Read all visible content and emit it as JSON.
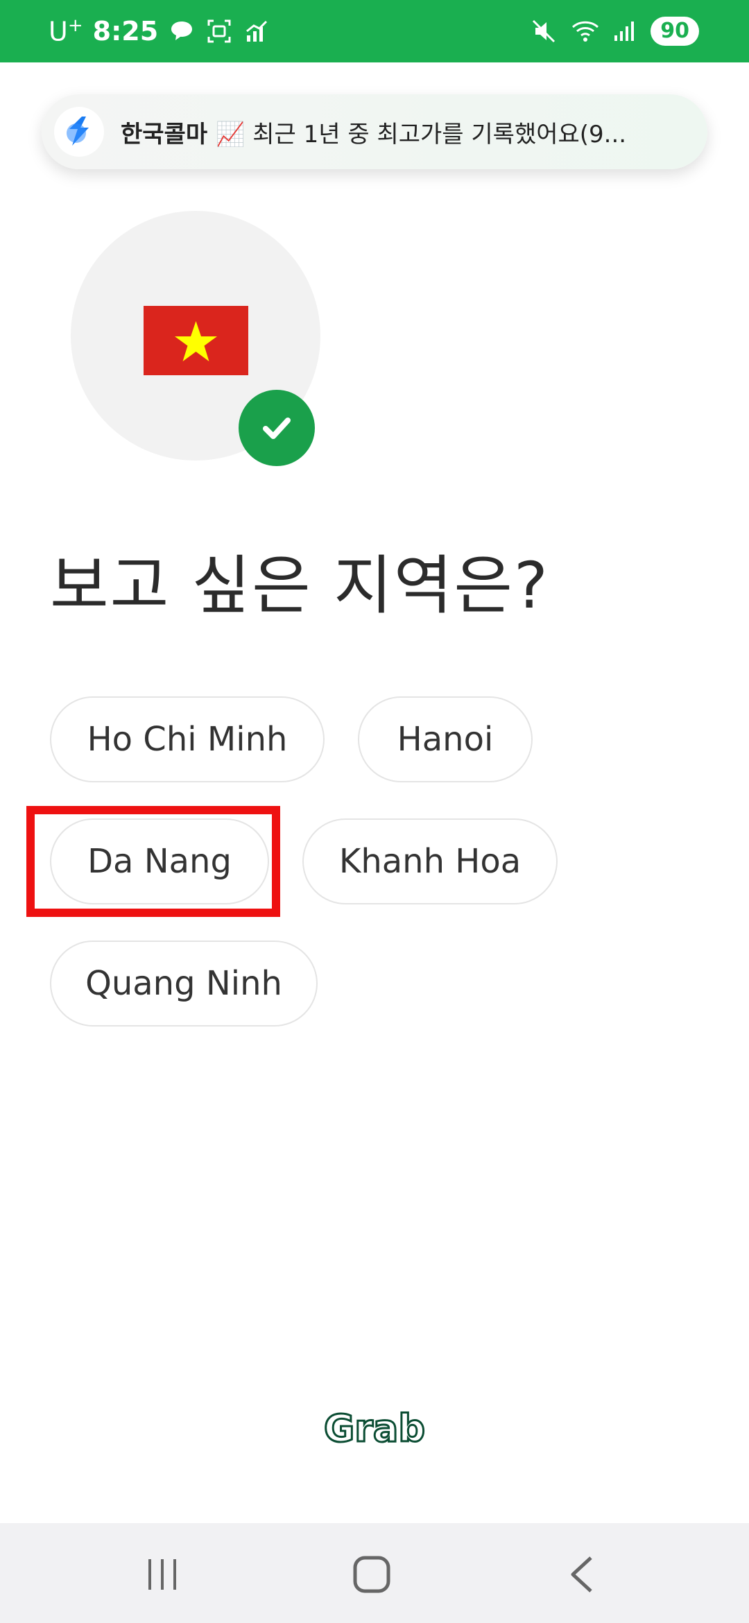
{
  "status_bar": {
    "carrier": "U",
    "carrier_sup": "+",
    "time": "8:25",
    "battery": "90",
    "icons": [
      "chat-bubble-icon",
      "screenshot-icon",
      "chart-icon",
      "mute-icon",
      "wifi-icon",
      "signal-icon"
    ]
  },
  "notification": {
    "app_name": "한국콜마",
    "emoji": "📈",
    "message": "최근 1년 중 최고가를 기록했어요(9..."
  },
  "country": {
    "flag": "vietnam-flag",
    "selected": true
  },
  "title": "보고 싶은 지역은?",
  "regions": [
    {
      "label": "Ho Chi Minh"
    },
    {
      "label": "Hanoi"
    },
    {
      "label": "Da Nang",
      "highlighted": true
    },
    {
      "label": "Khanh Hoa"
    },
    {
      "label": "Quang Ninh"
    }
  ],
  "brand": {
    "logo_text": "Grab",
    "color": "#0b4d33"
  },
  "colors": {
    "status_bar": "#1aaf50",
    "check_badge": "#1aa04b",
    "flag_red": "#da251d",
    "flag_star": "#ffff00",
    "highlight": "#ee1111"
  },
  "nav_bar": {
    "buttons": [
      "recent-apps-icon",
      "home-icon",
      "back-icon"
    ]
  }
}
